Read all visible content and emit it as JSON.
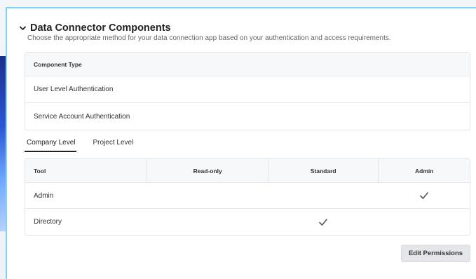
{
  "section": {
    "title": "Data Connector Components",
    "description": "Choose the appropriate method for your data connection app based on your authentication and access requirements."
  },
  "components": {
    "header": "Component Type",
    "rows": [
      "User Level Authentication",
      "Service Account Authentication"
    ]
  },
  "tabs": [
    {
      "label": "Company Level",
      "active": true
    },
    {
      "label": "Project Level",
      "active": false
    }
  ],
  "permissions": {
    "columns": [
      "Tool",
      "Read-only",
      "Standard",
      "Admin"
    ],
    "rows": [
      {
        "tool": "Admin",
        "read_only": false,
        "standard": false,
        "admin": true
      },
      {
        "tool": "Directory",
        "read_only": false,
        "standard": true,
        "admin": false
      }
    ]
  },
  "actions": {
    "edit_permissions": "Edit Permissions"
  }
}
